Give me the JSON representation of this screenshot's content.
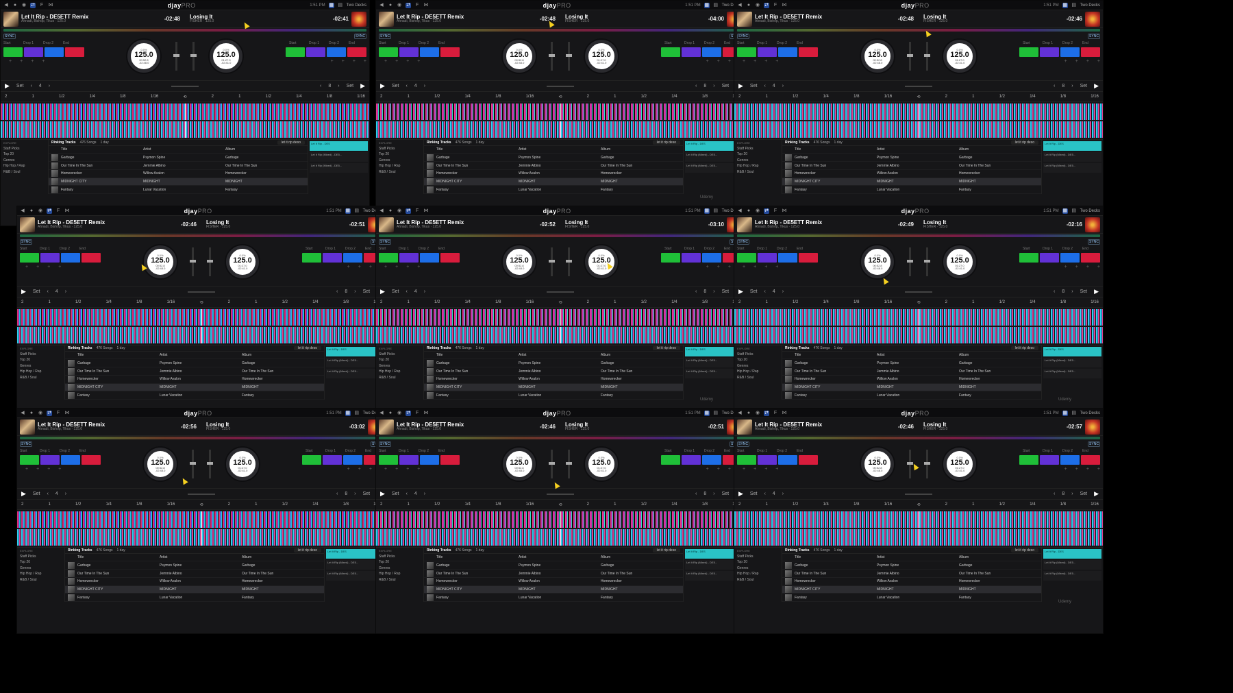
{
  "app": {
    "logo": "djay",
    "logo_suffix": "PRO",
    "layout_label": "Two Decks",
    "time": "1:51 PM",
    "watermark": "Udemy"
  },
  "deckA": {
    "title": "Let It Rip - DE5ETT Remix",
    "artist": "Ahnadi, Bishop, Tikus",
    "bpm_small": "125.0",
    "remaining": "-02:48",
    "jog_bpm": "125.0",
    "jog_pct": "0.0%",
    "jog_time1": "00:52.8",
    "jog_time2": "-02:48.0",
    "sync": "SYNC",
    "loop_beats": "4"
  },
  "deckB": {
    "title": "Losing It",
    "artist": "FISHER",
    "bpm_small": "125.0",
    "remaining": "-02:41",
    "jog_bpm": "125.0",
    "jog_pct": "0.0%",
    "jog_time1": "01:27.0",
    "jog_time2": "-02:41.0",
    "sync": "SYNC",
    "loop_beats": "8"
  },
  "cue_labels": [
    "Start",
    "Drop 1",
    "Drop 2",
    "End"
  ],
  "controls": {
    "set": "Set",
    "play": "▶"
  },
  "loop_values": [
    "2",
    "1",
    "1/2",
    "1/4",
    "1/8",
    "1/16"
  ],
  "library": {
    "source": "Rinking Tracks",
    "count": "476 Songs",
    "period": "1 day",
    "search": "let it rip deso",
    "explore": "EXPLORE",
    "sidebar": [
      "Staff Picks",
      "Top 20",
      "Genres",
      "Hip Hop / Rap",
      "R&B / Soul"
    ],
    "columns": [
      "Title",
      "Artist",
      "Album"
    ],
    "rows": [
      {
        "title": "Garbage",
        "artist": "Psymon Spine",
        "album": "Garbage"
      },
      {
        "title": "Our Time In The Sun",
        "artist": "Jemmie Albino",
        "album": "Our Time In The Sun"
      },
      {
        "title": "Homewrecker",
        "artist": "Willow Avalon",
        "album": "Homewrecker"
      },
      {
        "title": "MIDNIGHT CITY",
        "artist": "MIDNIGHT",
        "album": "MIDNIGHT"
      },
      {
        "title": "Fantasy",
        "artist": "Lunar Vacation",
        "album": "Fantasy"
      }
    ],
    "queue": [
      "Let It Rip - DES",
      "Let It Rip (Mixed) - DE5...",
      "Let It Rip (Mixed) - DE5..."
    ]
  },
  "panels": [
    {
      "tA": "-02:48",
      "tB": "-02:41"
    },
    {
      "tA": "-02:48",
      "tB": "-04:00"
    },
    {
      "tA": "-02:48",
      "tB": "-02:46"
    },
    {
      "tA": "-02:46",
      "tB": "-02:51"
    },
    {
      "tA": "-02:52",
      "tB": "-03:10"
    },
    {
      "tA": "-02:49",
      "tB": "-02:16"
    },
    {
      "tA": "-02:56",
      "tB": "-03:02"
    },
    {
      "tA": "-02:46",
      "tB": "-02:51"
    },
    {
      "tA": "-02:46",
      "tB": "-02:57"
    }
  ]
}
